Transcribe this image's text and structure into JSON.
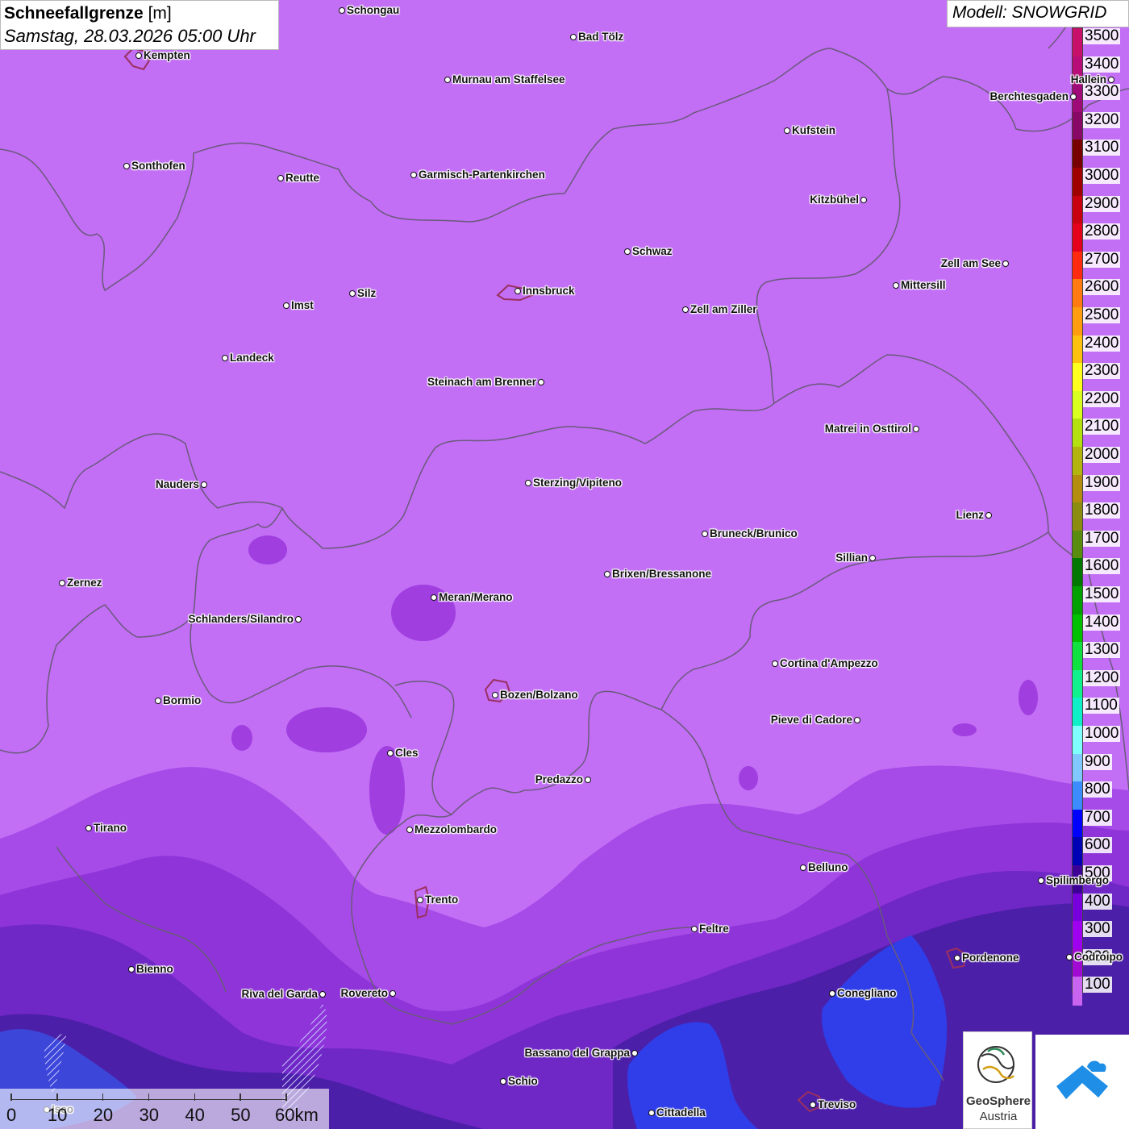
{
  "header": {
    "title": "Schneefallgrenze",
    "unit": "[m]",
    "datetime": "Samstag, 28.03.2026 05:00 Uhr"
  },
  "model": {
    "label": "Modell: SNOWGRID"
  },
  "legend": {
    "levels": [
      {
        "value": "3500",
        "color": "#c8106a"
      },
      {
        "value": "3400",
        "color": "#b80c78"
      },
      {
        "value": "3300",
        "color": "#a00a78"
      },
      {
        "value": "3200",
        "color": "#880868"
      },
      {
        "value": "3100",
        "color": "#780000"
      },
      {
        "value": "3000",
        "color": "#a00000"
      },
      {
        "value": "2900",
        "color": "#c80010"
      },
      {
        "value": "2800",
        "color": "#e4001c"
      },
      {
        "value": "2700",
        "color": "#ff2a10"
      },
      {
        "value": "2600",
        "color": "#ff7a10"
      },
      {
        "value": "2500",
        "color": "#ff9c10"
      },
      {
        "value": "2400",
        "color": "#ffc010"
      },
      {
        "value": "2300",
        "color": "#ffff20"
      },
      {
        "value": "2200",
        "color": "#d8ff20"
      },
      {
        "value": "2100",
        "color": "#b4e010"
      },
      {
        "value": "2000",
        "color": "#b4b410"
      },
      {
        "value": "1900",
        "color": "#b48c10"
      },
      {
        "value": "1800",
        "color": "#8c8c10"
      },
      {
        "value": "1700",
        "color": "#5a8c10"
      },
      {
        "value": "1600",
        "color": "#007800"
      },
      {
        "value": "1500",
        "color": "#00a000"
      },
      {
        "value": "1400",
        "color": "#00c000"
      },
      {
        "value": "1300",
        "color": "#10e040"
      },
      {
        "value": "1200",
        "color": "#10f08c"
      },
      {
        "value": "1100",
        "color": "#10f0c8"
      },
      {
        "value": "1000",
        "color": "#80ffff"
      },
      {
        "value": "900",
        "color": "#80c8ff"
      },
      {
        "value": "800",
        "color": "#3c8cff"
      },
      {
        "value": "700",
        "color": "#0000ff"
      },
      {
        "value": "600",
        "color": "#0000b4"
      },
      {
        "value": "500",
        "color": "#3c0096"
      },
      {
        "value": "400",
        "color": "#7800dc"
      },
      {
        "value": "300",
        "color": "#a000f0"
      },
      {
        "value": "200",
        "color": "#a00ad2"
      },
      {
        "value": "100",
        "color": "#c864f0"
      }
    ]
  },
  "cities": [
    {
      "name": "Schongau"
    },
    {
      "name": "Bad Tölz"
    },
    {
      "name": "Kempten"
    },
    {
      "name": "Murnau am Staffelsee"
    },
    {
      "name": "Berchtesgaden"
    },
    {
      "name": "Hallein"
    },
    {
      "name": "Kufstein"
    },
    {
      "name": "Sonthofen"
    },
    {
      "name": "Reutte"
    },
    {
      "name": "Garmisch-Partenkirchen"
    },
    {
      "name": "Kitzbühel"
    },
    {
      "name": "Schwaz"
    },
    {
      "name": "Zell am See"
    },
    {
      "name": "Innsbruck"
    },
    {
      "name": "Mittersill"
    },
    {
      "name": "Imst"
    },
    {
      "name": "Silz"
    },
    {
      "name": "Zell am Ziller"
    },
    {
      "name": "Landeck"
    },
    {
      "name": "Steinach am Brenner"
    },
    {
      "name": "Matrei in Osttirol"
    },
    {
      "name": "Nauders"
    },
    {
      "name": "Sterzing/Vipiteno"
    },
    {
      "name": "Lienz"
    },
    {
      "name": "Bruneck/Brunico"
    },
    {
      "name": "Sillian"
    },
    {
      "name": "Zernez"
    },
    {
      "name": "Brixen/Bressanone"
    },
    {
      "name": "Meran/Merano"
    },
    {
      "name": "Schlanders/Silandro"
    },
    {
      "name": "Cortina d'Ampezzo"
    },
    {
      "name": "Bozen/Bolzano"
    },
    {
      "name": "Bormio"
    },
    {
      "name": "Pieve di Cadore"
    },
    {
      "name": "Cles"
    },
    {
      "name": "Predazzo"
    },
    {
      "name": "Tirano"
    },
    {
      "name": "Mezzolombardo"
    },
    {
      "name": "Belluno"
    },
    {
      "name": "Spilimbergo"
    },
    {
      "name": "Trento"
    },
    {
      "name": "Feltre"
    },
    {
      "name": "Pordenone"
    },
    {
      "name": "Codroipo"
    },
    {
      "name": "Bienno"
    },
    {
      "name": "Riva del Garda"
    },
    {
      "name": "Rovereto"
    },
    {
      "name": "Conegliano"
    },
    {
      "name": "Bassano del Grappa"
    },
    {
      "name": "Schio"
    },
    {
      "name": "Iseo"
    },
    {
      "name": "Treviso"
    },
    {
      "name": "Cittadella"
    }
  ],
  "scale": {
    "ticks": [
      "0",
      "10",
      "20",
      "30",
      "40",
      "50",
      "60km"
    ]
  },
  "logos": {
    "geosphere_name": "GeoSphere",
    "geosphere_sub": "Austria"
  },
  "colors": {
    "base_fill": "#c26ef5",
    "band_200": "#a036e6",
    "band_300": "#8a2ad8",
    "band_400": "#6a24c4",
    "band_500": "#4a1aa8",
    "band_700": "#2838e6",
    "border": "#6a5a7a"
  }
}
